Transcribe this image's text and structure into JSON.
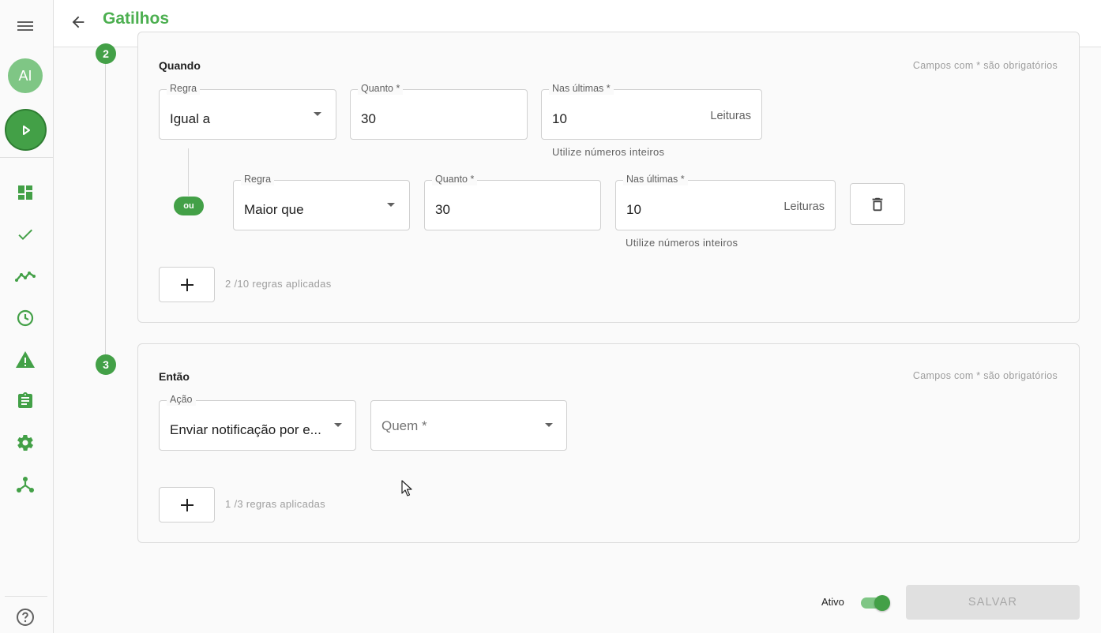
{
  "header": {
    "title": "Gatilhos"
  },
  "sidebar": {
    "avatar_initials": "AI"
  },
  "step2": {
    "number": "2",
    "title": "Quando",
    "required_note": "Campos com * são obrigatórios",
    "rule1": {
      "rule_label": "Regra",
      "rule_value": "Igual a",
      "amount_label": "Quanto *",
      "amount_value": "30",
      "last_label": "Nas últimas *",
      "last_value": "10",
      "last_suffix": "Leituras",
      "helper": "Utilize números inteiros"
    },
    "or_label": "ou",
    "rule2": {
      "rule_label": "Regra",
      "rule_value": "Maior que",
      "amount_label": "Quanto *",
      "amount_value": "30",
      "last_label": "Nas últimas *",
      "last_value": "10",
      "last_suffix": "Leituras",
      "helper": "Utilize números inteiros"
    },
    "rules_count": "2 /10 regras aplicadas"
  },
  "step3": {
    "number": "3",
    "title": "Então",
    "required_note": "Campos com * são obrigatórios",
    "action_label": "Ação",
    "action_value": "Enviar notificação por e...",
    "who_placeholder": "Quem *",
    "rules_count": "1 /3 regras aplicadas"
  },
  "footer": {
    "active_label": "Ativo",
    "active": true,
    "save_label": "SALVAR"
  },
  "colors": {
    "accent": "#43a047",
    "accent_light": "#7fc685"
  }
}
